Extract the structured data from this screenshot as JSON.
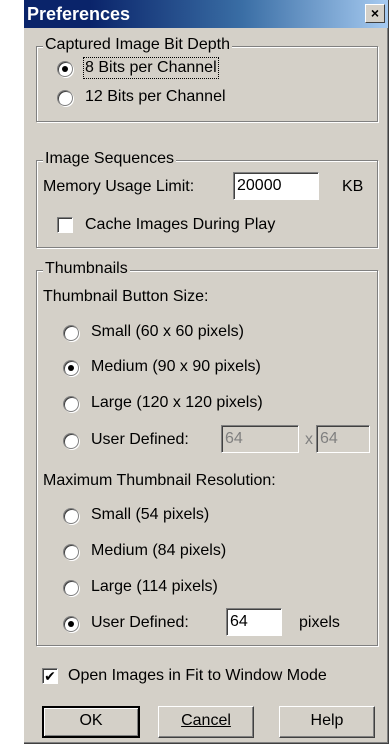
{
  "window": {
    "title": "Preferences",
    "close_glyph": "×"
  },
  "bit_depth": {
    "legend": "Captured Image Bit Depth",
    "options": [
      {
        "label": "8 Bits per Channel",
        "selected": true
      },
      {
        "label": "12 Bits per Channel",
        "selected": false
      }
    ]
  },
  "sequences": {
    "legend": "Image Sequences",
    "memory_label": "Memory Usage Limit:",
    "memory_value": "20000",
    "memory_unit": "KB",
    "cache_label": "Cache Images During Play",
    "cache_checked": false
  },
  "thumbnails": {
    "legend": "Thumbnails",
    "button_size_label": "Thumbnail Button Size:",
    "button_sizes": [
      {
        "label": "Small (60 x 60 pixels)",
        "selected": false
      },
      {
        "label": "Medium (90 x 90 pixels)",
        "selected": true
      },
      {
        "label": "Large (120 x 120 pixels)",
        "selected": false
      },
      {
        "label": "User Defined:",
        "selected": false
      }
    ],
    "user_width": "64",
    "times": "x",
    "user_height": "64",
    "resolution_label": "Maximum Thumbnail Resolution:",
    "resolutions": [
      {
        "label": "Small (54 pixels)",
        "selected": false
      },
      {
        "label": "Medium (84 pixels)",
        "selected": false
      },
      {
        "label": "Large (114 pixels)",
        "selected": false
      },
      {
        "label": "User Defined:",
        "selected": true
      }
    ],
    "user_resolution": "64",
    "resolution_unit": "pixels"
  },
  "fit_window": {
    "label": "Open Images in Fit to Window Mode",
    "checked": true,
    "check_glyph": "✔"
  },
  "buttons": {
    "ok": "OK",
    "cancel": "Cancel",
    "help": "Help"
  }
}
